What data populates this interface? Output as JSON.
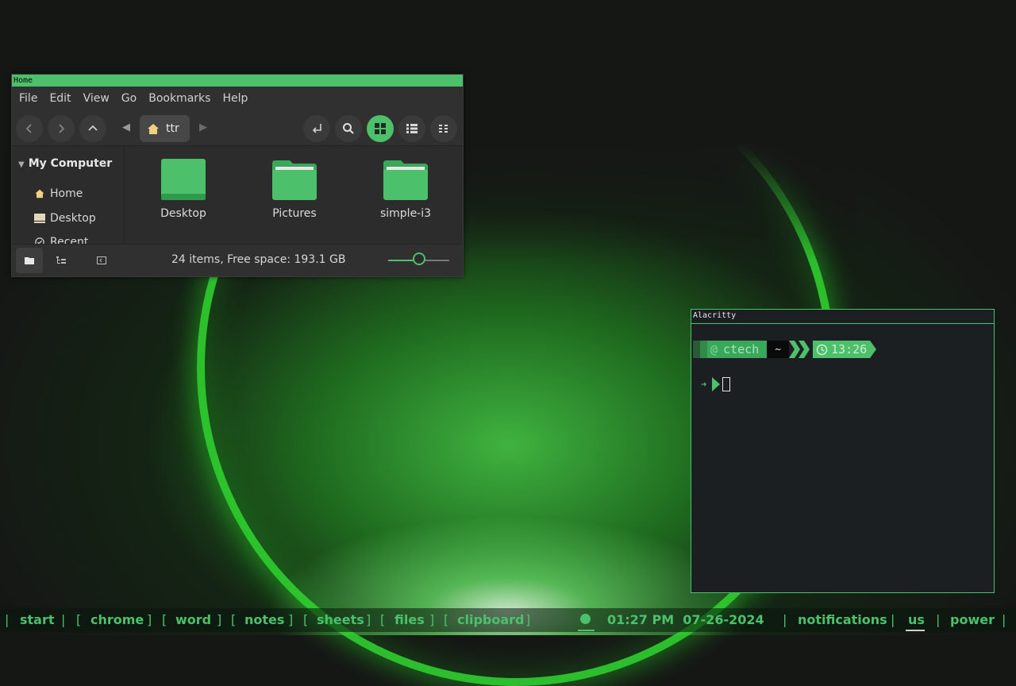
{
  "colors": {
    "accent": "#4cc06a",
    "window_bg": "#2c2c2c",
    "terminal_bg": "#1c1f21"
  },
  "file_manager": {
    "title": "Home",
    "menu": [
      "File",
      "Edit",
      "View",
      "Go",
      "Bookmarks",
      "Help"
    ],
    "path_label": "ttr",
    "sidebar": {
      "section": "My Computer",
      "items": [
        "Home",
        "Desktop",
        "Recent"
      ]
    },
    "files": [
      "Desktop",
      "Pictures",
      "simple-i3"
    ],
    "status": "24 items, Free space: 193.1 GB",
    "zoom_level": 0.5
  },
  "terminal": {
    "title": "Alacritty",
    "user": "ctech",
    "dir": "~",
    "time": "13:26",
    "arrow": "➜"
  },
  "taskbar": {
    "start": "start",
    "apps": [
      "chrome",
      "word",
      "notes",
      "sheets",
      "files",
      "clipboard"
    ],
    "datetime": "01:27 PM  07-26-2024",
    "notifications": "notifications",
    "layout": "us",
    "power": "power"
  }
}
